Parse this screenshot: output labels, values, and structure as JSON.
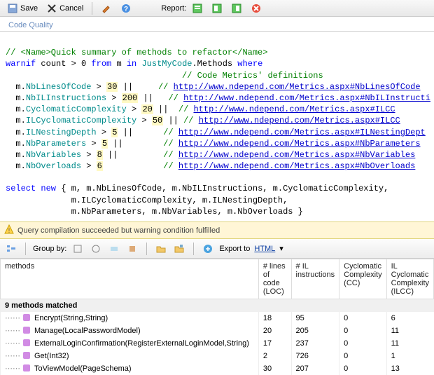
{
  "toolbar": {
    "save": "Save",
    "cancel": "Cancel",
    "report": "Report:"
  },
  "tab": {
    "label": "Code Quality"
  },
  "code": {
    "l1": "// <Name>Quick summary of methods to refactor</Name>",
    "l2a": "warnif",
    "l2b": " count > ",
    "l2c": "0",
    "l2d": " from",
    "l2e": " m ",
    "l2f": "in",
    "l2g": " JustMyCode",
    "l2h": ".Methods ",
    "l2i": "where",
    "l3c": "// Code Metrics' definitions",
    "m1a": "  m.",
    "m1b": "NbLinesOfCode",
    "m1c": " > ",
    "m1n": "30",
    "m1d": " ||     ",
    "m1u": "http://www.ndepend.com/Metrics.aspx#NbLinesOfCode",
    "m2a": "  m.",
    "m2b": "NbILInstructions",
    "m2c": " > ",
    "m2n": "200",
    "m2d": " ||   ",
    "m2u": "http://www.ndepend.com/Metrics.aspx#NbILInstructi",
    "m3a": "  m.",
    "m3b": "CyclomaticComplexity",
    "m3c": " > ",
    "m3n": "20",
    "m3d": " ||  ",
    "m3u": "http://www.ndepend.com/Metrics.aspx#CC",
    "m4a": "  m.",
    "m4b": "ILCyclomaticComplexity",
    "m4c": " > ",
    "m4n": "50",
    "m4d": " || ",
    "m4u": "http://www.ndepend.com/Metrics.aspx#ILCC",
    "m5a": "  m.",
    "m5b": "ILNestingDepth",
    "m5c": " > ",
    "m5n": "5",
    "m5d": " ||      ",
    "m5u": "http://www.ndepend.com/Metrics.aspx#ILNestingDept",
    "m6a": "  m.",
    "m6b": "NbParameters",
    "m6c": " > ",
    "m6n": "5",
    "m6d": " ||        ",
    "m6u": "http://www.ndepend.com/Metrics.aspx#NbParameters",
    "m7a": "  m.",
    "m7b": "NbVariables",
    "m7c": " > ",
    "m7n": "8",
    "m7d": " ||         ",
    "m7u": "http://www.ndepend.com/Metrics.aspx#NbVariables",
    "m8a": "  m.",
    "m8b": "NbOverloads",
    "m8c": " > ",
    "m8n": "6",
    "m8d": "            ",
    "m8u": "http://www.ndepend.com/Metrics.aspx#NbOverloads",
    "cm": "// ",
    "sel1": "select new { m, m.NbLinesOfCode, m.NbILInstructions, m.CyclomaticComplexity,",
    "sel2": "             m.ILCyclomaticComplexity, m.ILNestingDepth,",
    "sel3": "             m.NbParameters, m.NbVariables, m.NbOverloads }",
    "selkw": "select new"
  },
  "status": {
    "text": "Query compilation succeeded but warning condition fulfilled"
  },
  "toolbar2": {
    "groupby": "Group by:",
    "export": "Export to ",
    "exporttarget": "HTML"
  },
  "cols": {
    "c0": "methods",
    "c1": "# lines of code (LOC)",
    "c2": "# IL instructions",
    "c3": "Cyclomatic Complexity (CC)",
    "c4": "IL Cyclomatic Complexity (ILCC)"
  },
  "group": "9 methods matched",
  "rows": [
    {
      "name": "Encrypt(String,String)",
      "loc": "18",
      "il": "95",
      "cc": "0",
      "ilcc": "6"
    },
    {
      "name": "Manage(LocalPasswordModel)",
      "loc": "20",
      "il": "205",
      "cc": "0",
      "ilcc": "11"
    },
    {
      "name": "ExternalLoginConfirmation(RegisterExternalLoginModel,String)",
      "loc": "17",
      "il": "237",
      "cc": "0",
      "ilcc": "11"
    },
    {
      "name": "Get(Int32)",
      "loc": "2",
      "il": "726",
      "cc": "0",
      "ilcc": "1"
    },
    {
      "name": "ToViewModel(PageSchema)",
      "loc": "30",
      "il": "207",
      "cc": "0",
      "ilcc": "13"
    }
  ]
}
